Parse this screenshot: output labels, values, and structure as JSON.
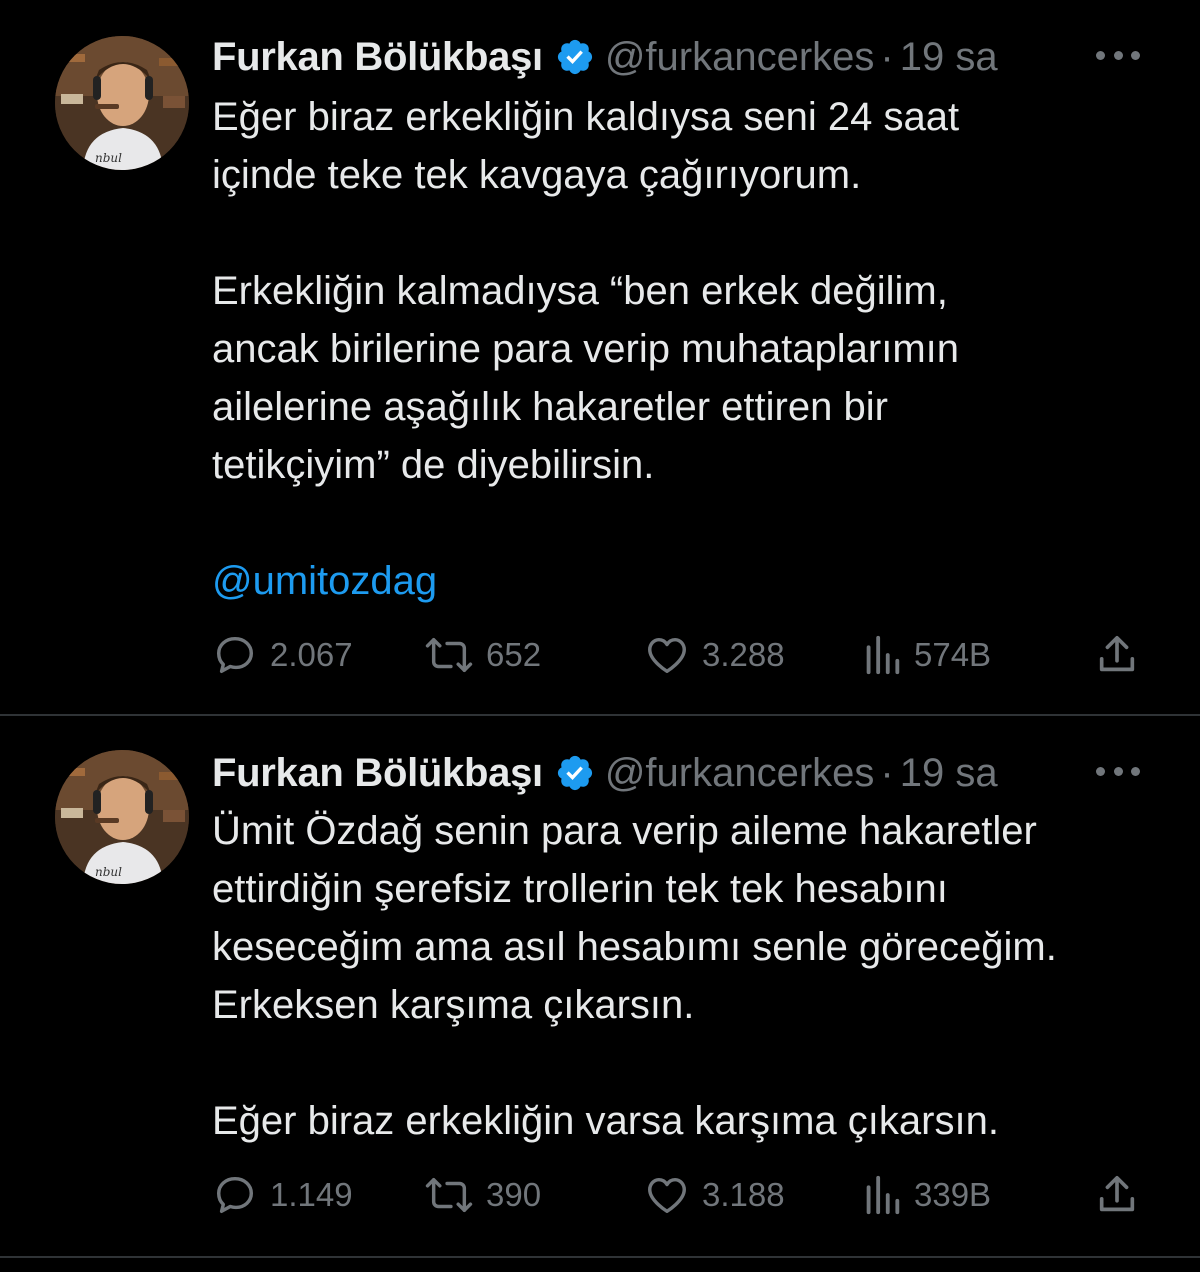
{
  "tweets": [
    {
      "author_name": "Furkan Bölükbaşı",
      "handle": "@furkancerkes",
      "separator": "·",
      "time": "19 sa",
      "body_lines": [
        "Eğer biraz erkekliğin kaldıysa seni 24 saat",
        "içinde teke tek kavgaya çağırıyorum.",
        "",
        "Erkekliğin kalmadıysa “ben erkek değilim,",
        "ancak birilerine para verip muhataplarımın",
        "ailelerine aşağılık hakaretler ettiren bir",
        "tetikçiyim” de diyebilirsin.",
        ""
      ],
      "mention": "@umitozdag",
      "replies": "2.067",
      "retweets": "652",
      "likes": "3.288",
      "views": "574B"
    },
    {
      "author_name": "Furkan Bölükbaşı",
      "handle": "@furkancerkes",
      "separator": "·",
      "time": "19 sa",
      "body_lines": [
        "Ümit Özdağ senin para verip aileme hakaretler",
        "ettirdiğin şerefsiz trollerin tek tek hesabını",
        "keseceğim ama asıl hesabımı senle göreceğim.",
        "Erkeksen karşıma çıkarsın.",
        "",
        "Eğer biraz erkekliğin varsa karşıma çıkarsın."
      ],
      "replies": "1.149",
      "retweets": "390",
      "likes": "3.188",
      "views": "339B"
    }
  ],
  "colors": {
    "background": "#000000",
    "text": "#e7e9ea",
    "secondary": "#71767b",
    "accent": "#1d9bf0",
    "divider": "#2f3336"
  },
  "icons": [
    "verified-badge-icon",
    "more-icon",
    "reply-icon",
    "retweet-icon",
    "like-icon",
    "views-icon",
    "share-icon"
  ]
}
